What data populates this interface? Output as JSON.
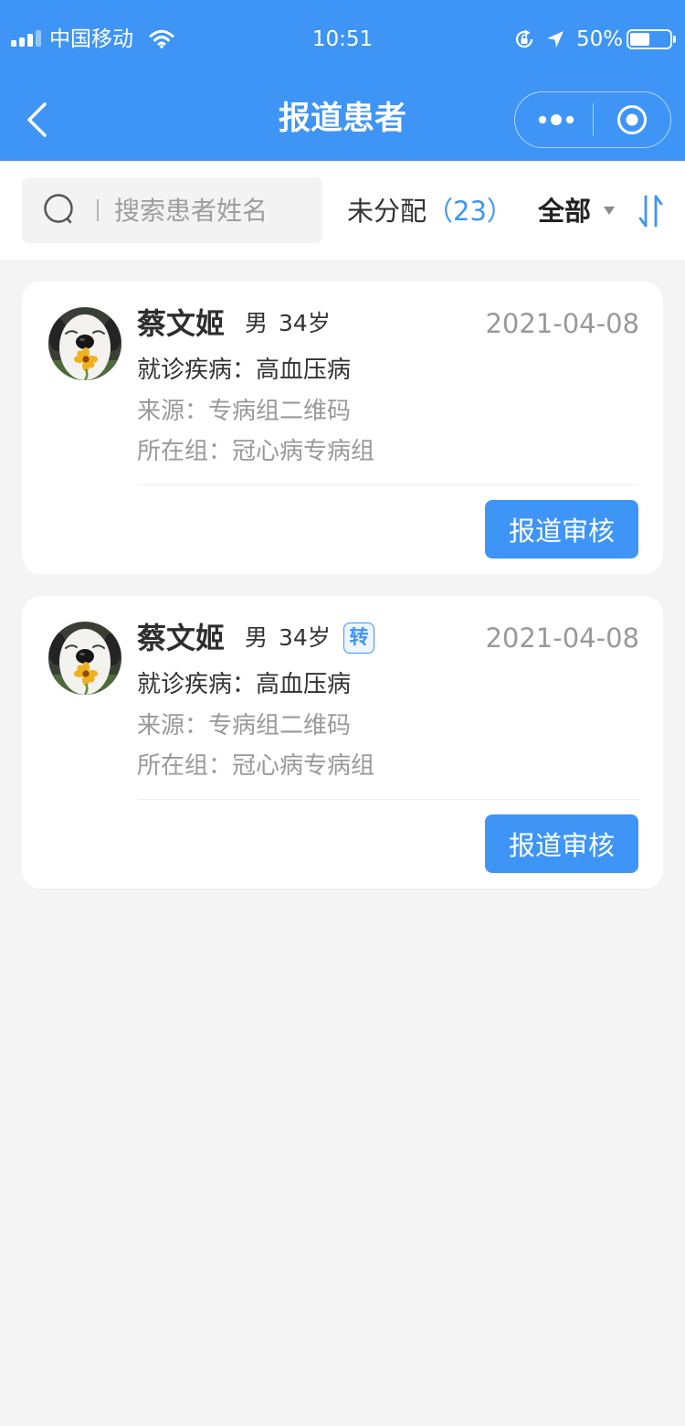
{
  "theme": {
    "primary": "#3e95f6",
    "page_background": "#f4f4f4",
    "text_primary": "#333333",
    "text_secondary": "#999999"
  },
  "status_bar": {
    "carrier": "中国移动",
    "time": "10:51",
    "battery_text": "50%",
    "battery_level": 0.5,
    "icons": [
      "signal-icon",
      "wifi-icon",
      "orientation-lock-icon",
      "location-arrow-icon",
      "battery-icon"
    ]
  },
  "nav": {
    "title": "报道患者",
    "back_icon": "chevron-left-icon",
    "more_icon": "more-dots-icon",
    "close_icon": "target-icon"
  },
  "filter": {
    "search_icon": "search-icon",
    "search_placeholder": "搜索患者姓名",
    "search_value": "",
    "unassigned_label": "未分配",
    "unassigned_count": "（23）",
    "scope_selected": "全部",
    "scope_icon": "caret-down-icon",
    "sort_icon": "sort-icon"
  },
  "patients": [
    {
      "name": "蔡文姬",
      "gender": "男",
      "age": "34岁",
      "date": "2021-04-08",
      "disease_label": "就诊疾病：",
      "disease": "高血压病",
      "source_label": "来源：",
      "source": "专病组二维码",
      "group_label": "所在组：",
      "group": "冠心病专病组",
      "action": "报道审核"
    },
    {
      "name": "蔡文姬",
      "gender": "男",
      "age": "34岁",
      "badge": "转",
      "date": "2021-04-08",
      "disease_label": "就诊疾病：",
      "disease": "高血压病",
      "source_label": "来源：",
      "source": "专病组二维码",
      "group_label": "所在组：",
      "group": "冠心病专病组",
      "action": "报道审核"
    }
  ]
}
